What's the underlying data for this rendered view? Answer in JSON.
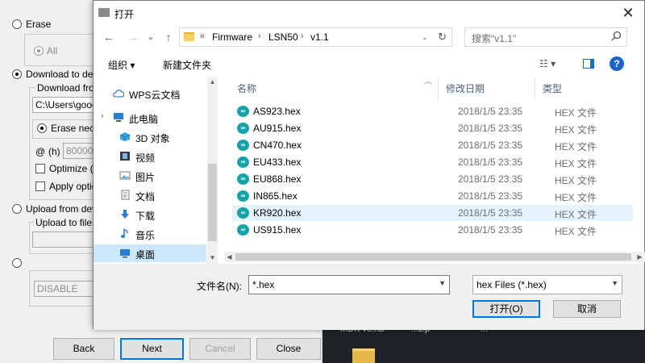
{
  "desktop": {
    "items": [
      "MDK v5.rar",
      "...zip",
      "..."
    ]
  },
  "wizard": {
    "erase_label": "Erase",
    "all_label": "All",
    "download_label": "Download to devi",
    "download_from_label": "Download from",
    "path_value": "C:\\Users\\good",
    "erase_nece_label": "Erase nece",
    "at_label": "@",
    "h_label": "(h)",
    "addr_value": "80000",
    "optimize_label": "Optimize (R",
    "apply_label": "Apply optior",
    "upload_label": "Upload from devi",
    "upload_to_label": "Upload to file",
    "disable_value": "DISABLE",
    "buttons": {
      "back": "Back",
      "next": "Next",
      "cancel": "Cancel",
      "close": "Close"
    }
  },
  "dialog": {
    "title": "打开",
    "close_glyph": "✕",
    "nav": {
      "back": "←",
      "forward": "→",
      "dropdown": "⌄",
      "up": "↑",
      "crumb_prefix": "«",
      "crumbs": [
        "Firmware",
        "LSN50",
        "v1.1"
      ],
      "sep": "›",
      "refresh": "↻",
      "search_placeholder": "搜索\"v1.1\""
    },
    "toolbar": {
      "organize": "组织 ▾",
      "new_folder": "新建文件夹",
      "view_glyph": "☷ ▾",
      "help": "?"
    },
    "tree": [
      {
        "label": "WPS云文档",
        "icon": "cloud-icon",
        "color": "#3b82d6"
      },
      {
        "label": "此电脑",
        "icon": "computer-icon",
        "color": "#2b7cd3"
      },
      {
        "label": "3D 对象",
        "icon": "cube-icon",
        "color": "#35a4e0"
      },
      {
        "label": "视频",
        "icon": "film-icon",
        "color": "#3a3a3a"
      },
      {
        "label": "图片",
        "icon": "picture-icon",
        "color": "#6aa2d8"
      },
      {
        "label": "文档",
        "icon": "document-icon",
        "color": "#8a8a8a"
      },
      {
        "label": "下载",
        "icon": "download-arrow-icon",
        "color": "#2b7cd3"
      },
      {
        "label": "音乐",
        "icon": "music-note-icon",
        "color": "#2b7cd3"
      },
      {
        "label": "桌面",
        "icon": "desktop-icon",
        "color": "#2b7cd3"
      }
    ],
    "columns": {
      "name": "名称",
      "date": "修改日期",
      "type": "类型"
    },
    "files": [
      {
        "name": "AS923.hex",
        "date": "2018/1/5 23:35",
        "type": "HEX 文件"
      },
      {
        "name": "AU915.hex",
        "date": "2018/1/5 23:35",
        "type": "HEX 文件"
      },
      {
        "name": "CN470.hex",
        "date": "2018/1/5 23:35",
        "type": "HEX 文件"
      },
      {
        "name": "EU433.hex",
        "date": "2018/1/5 23:35",
        "type": "HEX 文件"
      },
      {
        "name": "EU868.hex",
        "date": "2018/1/5 23:35",
        "type": "HEX 文件"
      },
      {
        "name": "IN865.hex",
        "date": "2018/1/5 23:35",
        "type": "HEX 文件"
      },
      {
        "name": "KR920.hex",
        "date": "2018/1/5 23:35",
        "type": "HEX 文件"
      },
      {
        "name": "US915.hex",
        "date": "2018/1/5 23:35",
        "type": "HEX 文件"
      }
    ],
    "file_icon_glyph": "∞",
    "bottom": {
      "filename_label": "文件名(N):",
      "filename_value": "*.hex",
      "filetype_value": "hex Files (*.hex)",
      "open_button": "打开(O)",
      "cancel_button": "取消"
    }
  },
  "colors": {
    "selected": "#cce8ff",
    "hover": "#e5f3ff",
    "accent": "#0078d7",
    "hex_icon": "#16a3a8"
  }
}
